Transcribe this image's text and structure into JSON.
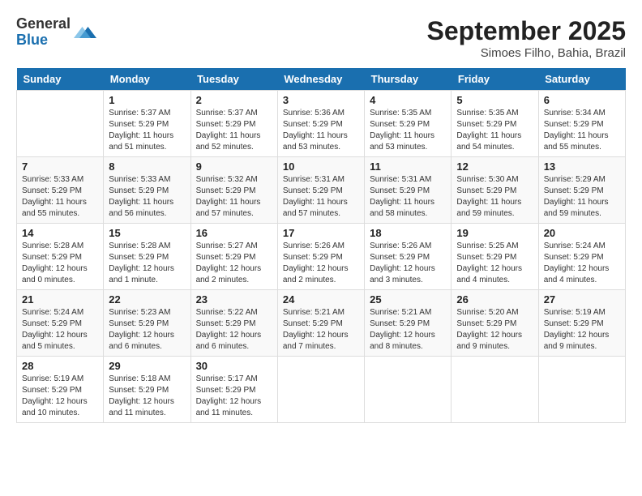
{
  "logo": {
    "general": "General",
    "blue": "Blue"
  },
  "title": "September 2025",
  "subtitle": "Simoes Filho, Bahia, Brazil",
  "days_of_week": [
    "Sunday",
    "Monday",
    "Tuesday",
    "Wednesday",
    "Thursday",
    "Friday",
    "Saturday"
  ],
  "weeks": [
    [
      {
        "day": "",
        "info": ""
      },
      {
        "day": "1",
        "info": "Sunrise: 5:37 AM\nSunset: 5:29 PM\nDaylight: 11 hours\nand 51 minutes."
      },
      {
        "day": "2",
        "info": "Sunrise: 5:37 AM\nSunset: 5:29 PM\nDaylight: 11 hours\nand 52 minutes."
      },
      {
        "day": "3",
        "info": "Sunrise: 5:36 AM\nSunset: 5:29 PM\nDaylight: 11 hours\nand 53 minutes."
      },
      {
        "day": "4",
        "info": "Sunrise: 5:35 AM\nSunset: 5:29 PM\nDaylight: 11 hours\nand 53 minutes."
      },
      {
        "day": "5",
        "info": "Sunrise: 5:35 AM\nSunset: 5:29 PM\nDaylight: 11 hours\nand 54 minutes."
      },
      {
        "day": "6",
        "info": "Sunrise: 5:34 AM\nSunset: 5:29 PM\nDaylight: 11 hours\nand 55 minutes."
      }
    ],
    [
      {
        "day": "7",
        "info": "Sunrise: 5:33 AM\nSunset: 5:29 PM\nDaylight: 11 hours\nand 55 minutes."
      },
      {
        "day": "8",
        "info": "Sunrise: 5:33 AM\nSunset: 5:29 PM\nDaylight: 11 hours\nand 56 minutes."
      },
      {
        "day": "9",
        "info": "Sunrise: 5:32 AM\nSunset: 5:29 PM\nDaylight: 11 hours\nand 57 minutes."
      },
      {
        "day": "10",
        "info": "Sunrise: 5:31 AM\nSunset: 5:29 PM\nDaylight: 11 hours\nand 57 minutes."
      },
      {
        "day": "11",
        "info": "Sunrise: 5:31 AM\nSunset: 5:29 PM\nDaylight: 11 hours\nand 58 minutes."
      },
      {
        "day": "12",
        "info": "Sunrise: 5:30 AM\nSunset: 5:29 PM\nDaylight: 11 hours\nand 59 minutes."
      },
      {
        "day": "13",
        "info": "Sunrise: 5:29 AM\nSunset: 5:29 PM\nDaylight: 11 hours\nand 59 minutes."
      }
    ],
    [
      {
        "day": "14",
        "info": "Sunrise: 5:28 AM\nSunset: 5:29 PM\nDaylight: 12 hours\nand 0 minutes."
      },
      {
        "day": "15",
        "info": "Sunrise: 5:28 AM\nSunset: 5:29 PM\nDaylight: 12 hours\nand 1 minute."
      },
      {
        "day": "16",
        "info": "Sunrise: 5:27 AM\nSunset: 5:29 PM\nDaylight: 12 hours\nand 2 minutes."
      },
      {
        "day": "17",
        "info": "Sunrise: 5:26 AM\nSunset: 5:29 PM\nDaylight: 12 hours\nand 2 minutes."
      },
      {
        "day": "18",
        "info": "Sunrise: 5:26 AM\nSunset: 5:29 PM\nDaylight: 12 hours\nand 3 minutes."
      },
      {
        "day": "19",
        "info": "Sunrise: 5:25 AM\nSunset: 5:29 PM\nDaylight: 12 hours\nand 4 minutes."
      },
      {
        "day": "20",
        "info": "Sunrise: 5:24 AM\nSunset: 5:29 PM\nDaylight: 12 hours\nand 4 minutes."
      }
    ],
    [
      {
        "day": "21",
        "info": "Sunrise: 5:24 AM\nSunset: 5:29 PM\nDaylight: 12 hours\nand 5 minutes."
      },
      {
        "day": "22",
        "info": "Sunrise: 5:23 AM\nSunset: 5:29 PM\nDaylight: 12 hours\nand 6 minutes."
      },
      {
        "day": "23",
        "info": "Sunrise: 5:22 AM\nSunset: 5:29 PM\nDaylight: 12 hours\nand 6 minutes."
      },
      {
        "day": "24",
        "info": "Sunrise: 5:21 AM\nSunset: 5:29 PM\nDaylight: 12 hours\nand 7 minutes."
      },
      {
        "day": "25",
        "info": "Sunrise: 5:21 AM\nSunset: 5:29 PM\nDaylight: 12 hours\nand 8 minutes."
      },
      {
        "day": "26",
        "info": "Sunrise: 5:20 AM\nSunset: 5:29 PM\nDaylight: 12 hours\nand 9 minutes."
      },
      {
        "day": "27",
        "info": "Sunrise: 5:19 AM\nSunset: 5:29 PM\nDaylight: 12 hours\nand 9 minutes."
      }
    ],
    [
      {
        "day": "28",
        "info": "Sunrise: 5:19 AM\nSunset: 5:29 PM\nDaylight: 12 hours\nand 10 minutes."
      },
      {
        "day": "29",
        "info": "Sunrise: 5:18 AM\nSunset: 5:29 PM\nDaylight: 12 hours\nand 11 minutes."
      },
      {
        "day": "30",
        "info": "Sunrise: 5:17 AM\nSunset: 5:29 PM\nDaylight: 12 hours\nand 11 minutes."
      },
      {
        "day": "",
        "info": ""
      },
      {
        "day": "",
        "info": ""
      },
      {
        "day": "",
        "info": ""
      },
      {
        "day": "",
        "info": ""
      }
    ]
  ]
}
